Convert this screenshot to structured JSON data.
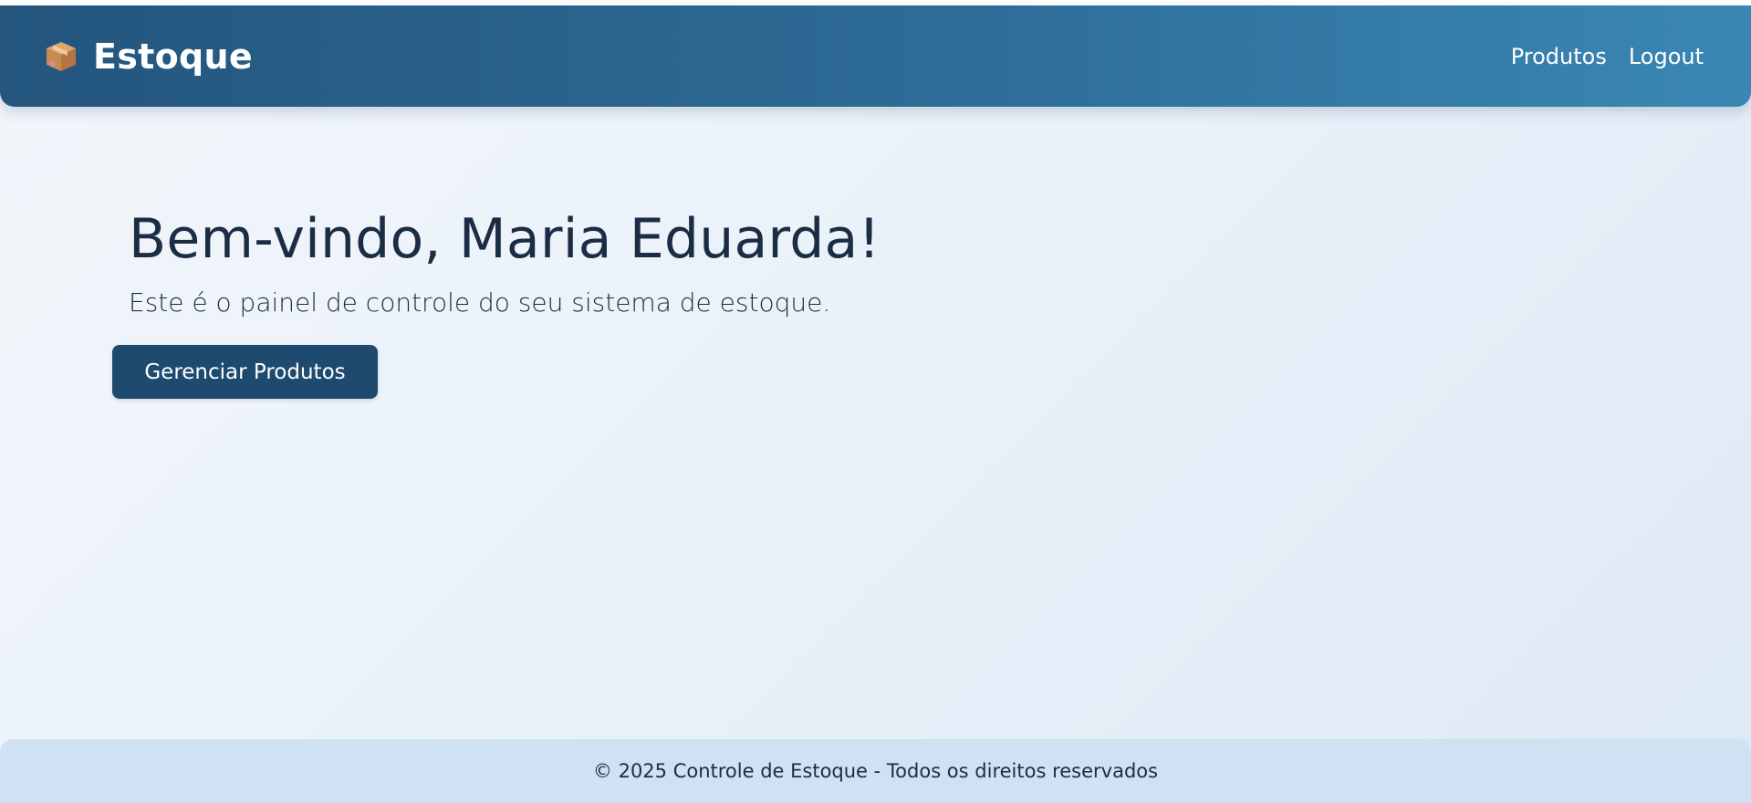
{
  "header": {
    "brand_icon": "package-icon",
    "brand_title": "Estoque",
    "nav": [
      {
        "label": "Produtos"
      },
      {
        "label": "Logout"
      }
    ]
  },
  "hero": {
    "title": "Bem-vindo, Maria Eduarda!",
    "subtitle": "Este é o painel de controle do seu sistema de estoque.",
    "button_label": "Gerenciar Produtos"
  },
  "footer": {
    "text": "© 2025 Controle de Estoque - Todos os direitos reservados"
  },
  "colors": {
    "navbar_start": "#23557d",
    "navbar_end": "#3a87b4",
    "button": "#1f4a6f",
    "text": "#1b2d44",
    "footer_bg": "#cfe1f2"
  }
}
